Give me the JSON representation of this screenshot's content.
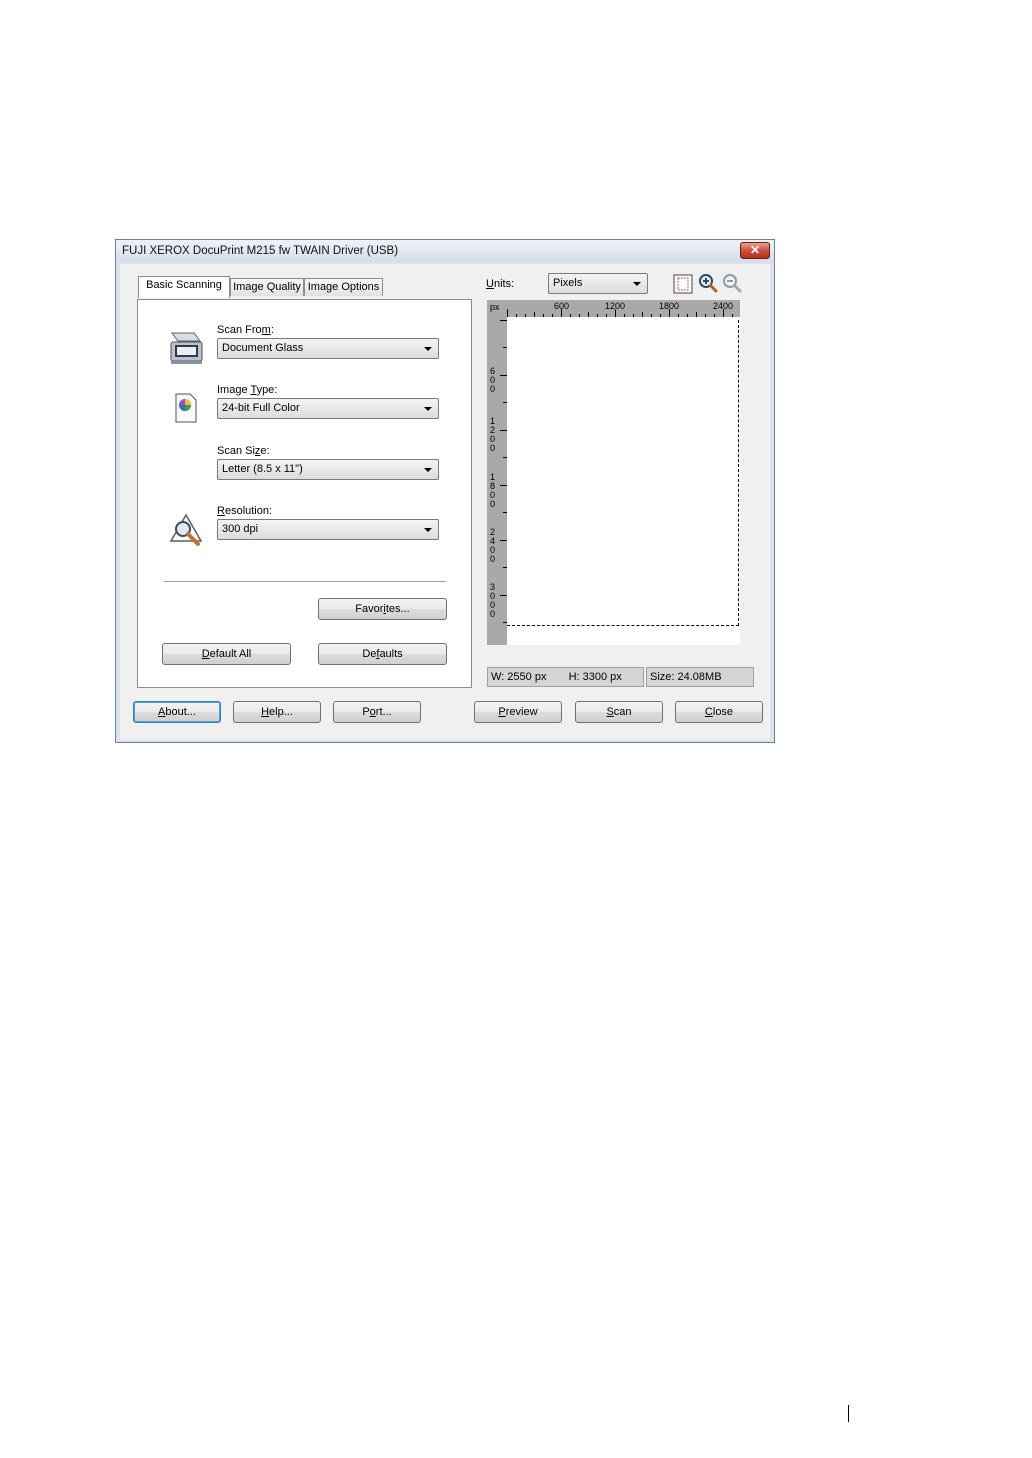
{
  "window": {
    "title": "FUJI XEROX DocuPrint M215 fw TWAIN Driver (USB)",
    "close_glyph": "✕"
  },
  "tabs": [
    {
      "label": "Basic Scanning",
      "active": true
    },
    {
      "label": "Image Quality",
      "active": false
    },
    {
      "label": "Image Options",
      "active": false
    }
  ],
  "fields": {
    "scan_from": {
      "label_pre": "Scan Fro",
      "label_key": "m",
      "label_post": ":",
      "value": "Document Glass",
      "icon": "scanner-icon"
    },
    "image_type": {
      "label_pre": "Image ",
      "label_key": "T",
      "label_post": "ype:",
      "value": "24-bit Full Color",
      "icon": "color-document-icon"
    },
    "scan_size": {
      "label_pre": "Scan Si",
      "label_key": "z",
      "label_post": "e:",
      "value": "Letter (8.5 x 11\")"
    },
    "resolution": {
      "label_pre": "",
      "label_key": "R",
      "label_post": "esolution:",
      "value": "300 dpi",
      "icon": "magnifier-resolution-icon"
    }
  },
  "panel_buttons": {
    "favorites": {
      "pre": "Favor",
      "key": "i",
      "post": "tes..."
    },
    "default_all": {
      "pre": "",
      "key": "D",
      "post": "efault All"
    },
    "defaults": {
      "pre": "De",
      "key": "f",
      "post": "aults"
    }
  },
  "preview": {
    "units_label_key": "U",
    "units_label_rest": "nits:",
    "units_value": "Pixels",
    "ruler_unit": "px",
    "h_ticks": [
      "600",
      "1200",
      "1800",
      "2400"
    ],
    "v_ticks": [
      "600",
      "1200",
      "1800",
      "2400",
      "3000"
    ],
    "tool_icons": [
      "select-area-icon",
      "zoom-in-icon",
      "zoom-out-icon"
    ]
  },
  "status": {
    "width": "W: 2550 px",
    "height": "H: 3300 px",
    "size": "Size: 24.08MB"
  },
  "bottom_buttons": {
    "about": {
      "pre": "",
      "key": "A",
      "post": "bout..."
    },
    "help": {
      "pre": "",
      "key": "H",
      "post": "elp..."
    },
    "port": {
      "pre": "P",
      "key": "o",
      "post": "rt..."
    },
    "preview": {
      "pre": "",
      "key": "P",
      "post": "review"
    },
    "scan": {
      "pre": "",
      "key": "S",
      "post": "can"
    },
    "close": {
      "pre": "",
      "key": "C",
      "post": "lose"
    }
  }
}
